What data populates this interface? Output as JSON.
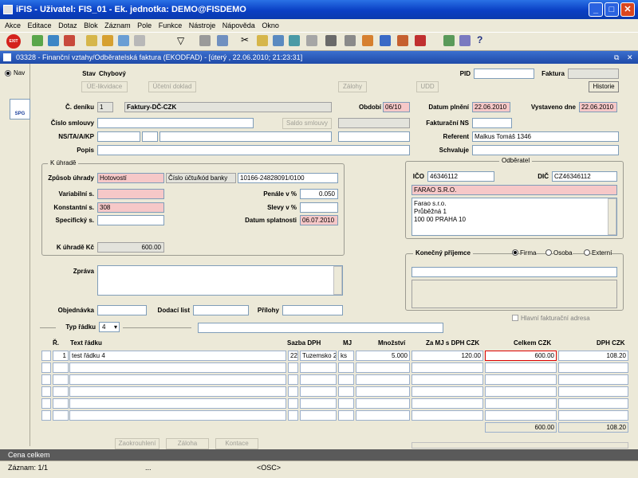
{
  "window": {
    "title": "iFIS - Uživatel: FIS_01 - Ek. jednotka: DEMO@FISDEMO",
    "min": "_",
    "max": "□",
    "close": "✕"
  },
  "menu": [
    "Akce",
    "Editace",
    "Dotaz",
    "Blok",
    "Záznam",
    "Pole",
    "Funkce",
    "Nástroje",
    "Nápověda",
    "Okno"
  ],
  "exit_label": "EXIT",
  "form": {
    "title": "03328 - Finanční vztahy/Odběratelská faktura (EKODFAD) - [úterý , 22.06.2010; 21:23:31]",
    "nav_label": "Nav",
    "spg_label": "SPG",
    "stav_label": "Stav",
    "stav_value": "Chybový",
    "pid_label": "PID",
    "faktura_label": "Faktura",
    "buttons": {
      "ue_likvidace": "ÚE-likvidace",
      "ucetni_doklad": "Účetní doklad",
      "zalohy": "Zálohy",
      "udd": "UDD",
      "historie": "Historie",
      "saldo": "Saldo smlouvy",
      "zaokrouhleni": "Zaokrouhlení",
      "zaloha": "Záloha",
      "kontace": "Kontace"
    },
    "c_deniku_label": "Č. deníku",
    "c_deniku_value": "1",
    "denik_name": "Faktury-DČ-CZK",
    "obdobi_label": "Období",
    "obdobi_value": "06/10",
    "datum_plneni_label": "Datum plnění",
    "datum_plneni_value": "22.06.2010",
    "vystaveno_label": "Vystaveno dne",
    "vystaveno_value": "22.06.2010",
    "cislo_smlouvy_label": "Číslo smlouvy",
    "fakturacni_ns_label": "Fakturační NS",
    "ns_label": "NS/TA/A/KP",
    "referent_label": "Referent",
    "referent_value": "Malkus Tomáš 1346",
    "popis_label": "Popis",
    "schvaluje_label": "Schvaluje",
    "k_uhrade_group": "K úhradě",
    "zpusob_label": "Způsob úhrady",
    "zpusob_value": "Hotovostí",
    "ucet_label": "Číslo účtu/kód banky",
    "ucet_value": "10166-24828091/0100",
    "variabilni_label": "Variabilní s.",
    "penale_label": "Penále v %",
    "penale_value": "0.050",
    "konstantni_label": "Konstantní s.",
    "konstantni_value": "308",
    "slevy_label": "Slevy v %",
    "specificky_label": "Specifický s.",
    "splatnost_label": "Datum splatnosti",
    "splatnost_value": "06.07.2010",
    "k_uhrade_kc_label": "K úhradě Kč",
    "k_uhrade_kc_value": "600.00",
    "odberatel_group": "Odběratel",
    "ico_label": "IČO",
    "ico_value": "46346112",
    "dic_label": "DIČ",
    "dic_value": "CZ46346112",
    "firma_name": "FARAO S.R.O.",
    "address": [
      "Farao s.r.o.",
      "Průběžná 1",
      "100 00 PRAHA 10"
    ],
    "konecny_label": "Konečný příjemce",
    "radio_firma": "Firma",
    "radio_osoba": "Osoba",
    "radio_externi": "Externí",
    "hlavni_adresa": "Hlavní fakturační adresa",
    "zprava_label": "Zpráva",
    "objednavka_label": "Objednávka",
    "dodaci_label": "Dodací list",
    "prilohy_label": "Přílohy",
    "typ_radku_label": "Typ řádku",
    "typ_radku_value": "4"
  },
  "table": {
    "headers": [
      "Ř.",
      "Text řádku",
      "Sazba DPH",
      "MJ",
      "Množství",
      "Za MJ s DPH CZK",
      "Celkem CZK",
      "DPH CZK"
    ],
    "rows": [
      {
        "r": "1",
        "text": "test řádku 4",
        "sazba": "22",
        "sazba_name": "Tuzemsko 2",
        "mj": "ks",
        "mnozstvi": "5.000",
        "za_mj": "120.00",
        "celkem": "600.00",
        "dph": "108.20"
      }
    ],
    "total_celkem": "600.00",
    "total_dph": "108.20"
  },
  "status": {
    "line1": "Cena celkem",
    "record": "Záznam: 1/1",
    "dots": "...",
    "osc": "<OSC>"
  }
}
